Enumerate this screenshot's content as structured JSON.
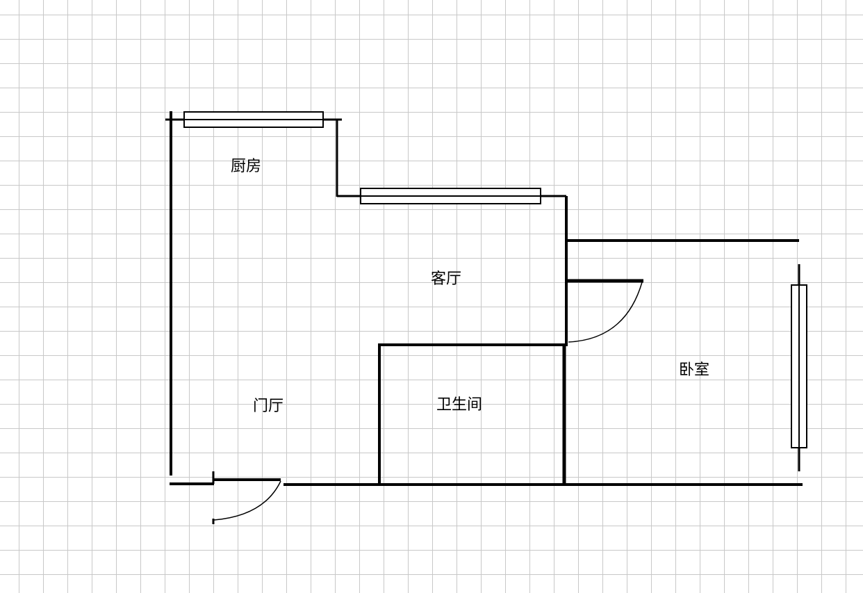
{
  "floorplan": {
    "rooms": {
      "kitchen": "厨房",
      "living_room": "客厅",
      "entry_hall": "门厅",
      "bathroom": "卫生间",
      "bedroom": "卧室"
    },
    "colors": {
      "wall": "#000000",
      "grid": "#c8c8c8",
      "background": "#ffffff"
    }
  }
}
